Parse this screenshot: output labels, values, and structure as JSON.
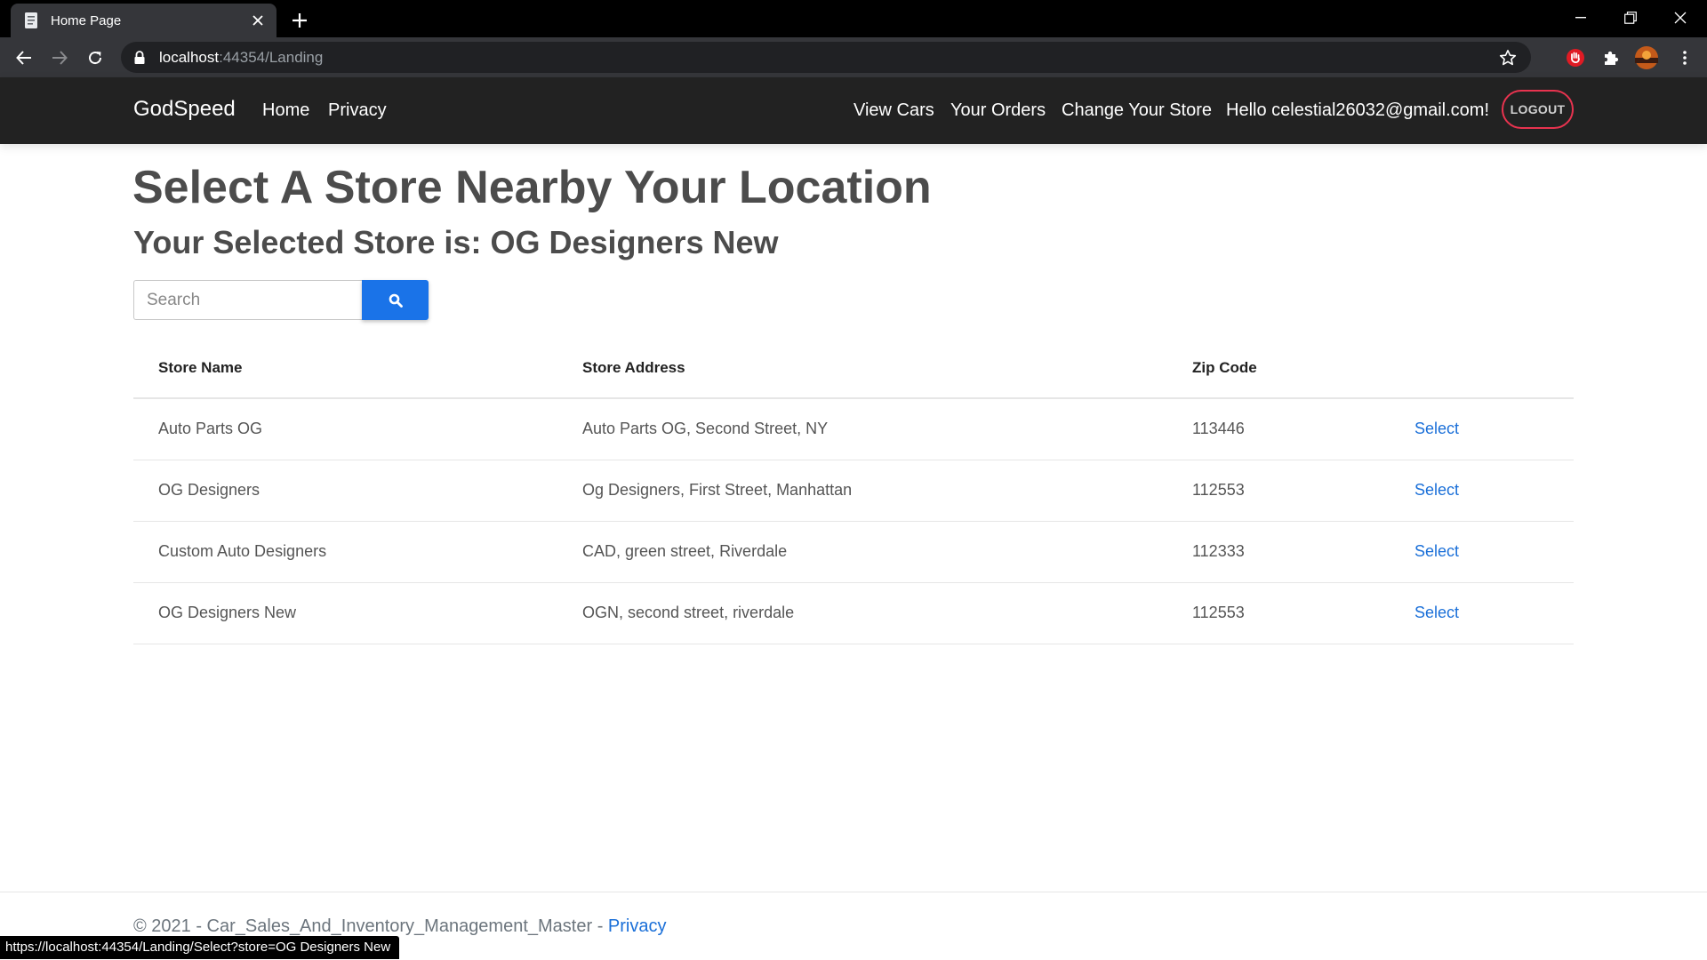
{
  "browser": {
    "tab_title": "Home Page",
    "url_host": "localhost",
    "url_rest": ":44354/Landing",
    "status_url": "https://localhost:44354/Landing/Select?store=OG Designers New"
  },
  "navbar": {
    "brand": "GodSpeed",
    "left_links": [
      "Home",
      "Privacy"
    ],
    "right_links": [
      "View Cars",
      "Your Orders",
      "Change Your Store"
    ],
    "greeting": "Hello celestial26032@gmail.com!",
    "logout_label": "LOGOUT"
  },
  "main": {
    "title": "Select A Store Nearby Your Location",
    "selected_store": "Your Selected Store is: OG Designers New",
    "search": {
      "placeholder": "Search",
      "value": ""
    }
  },
  "table": {
    "headers": [
      "Store Name",
      "Store Address",
      "Zip Code"
    ],
    "rows": [
      {
        "name": "Auto Parts OG",
        "address": "Auto Parts OG, Second Street, NY",
        "zip": "113446",
        "action": "Select"
      },
      {
        "name": "OG Designers",
        "address": "Og Designers, First Street, Manhattan",
        "zip": "112553",
        "action": "Select"
      },
      {
        "name": "Custom Auto Designers",
        "address": "CAD, green street, Riverdale",
        "zip": "112333",
        "action": "Select"
      },
      {
        "name": "OG Designers New",
        "address": "OGN, second street, riverdale",
        "zip": "112553",
        "action": "Select"
      }
    ]
  },
  "footer": {
    "copyright": "© 2021 - Car_Sales_And_Inventory_Management_Master - ",
    "privacy_link": "Privacy"
  },
  "colors": {
    "navbar_bg": "#222222",
    "accent_blue": "#1a73e8",
    "link_blue": "#1a6fd8",
    "logout_border": "#e8334f"
  },
  "icons": {
    "tab": "page-icon",
    "search_button": "search-icon",
    "omnibox": "lock-icon",
    "bookmark": "star-icon",
    "extensions": [
      "shield-extension-icon",
      "puzzle-extensions-icon",
      "profile-avatar"
    ]
  }
}
